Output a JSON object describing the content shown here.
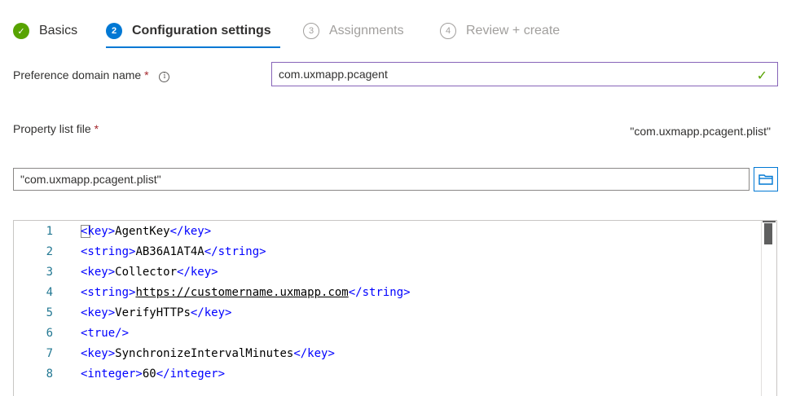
{
  "wizard": {
    "steps": [
      {
        "number": "✓",
        "label": "Basics",
        "state": "done"
      },
      {
        "number": "2",
        "label": "Configuration settings",
        "state": "active"
      },
      {
        "number": "3",
        "label": "Assignments",
        "state": "todo"
      },
      {
        "number": "4",
        "label": "Review + create",
        "state": "todo"
      }
    ]
  },
  "preference": {
    "label": "Preference domain name",
    "required_mark": "*",
    "info_icon": "info-icon",
    "value": "com.uxmapp.pcagent",
    "status_icon": "checkmark-icon"
  },
  "plist": {
    "label": "Property list file",
    "required_mark": "*",
    "selected_filename": "\"com.uxmapp.pcagent.plist\"",
    "field_value": "\"com.uxmapp.pcagent.plist\"",
    "browse_icon": "folder-icon"
  },
  "editor": {
    "lines": [
      {
        "num": "1",
        "text": "<key>AgentKey</key>"
      },
      {
        "num": "2",
        "text": "<string>AB36A1AT4A</string>"
      },
      {
        "num": "3",
        "text": "<key>Collector</key>"
      },
      {
        "num": "4",
        "text": "<string>https://customername.uxmapp.com</string>"
      },
      {
        "num": "5",
        "text": "<key>VerifyHTTPs</key>"
      },
      {
        "num": "6",
        "text": "<true/>"
      },
      {
        "num": "7",
        "text": "<key>SynchronizeIntervalMinutes</key>"
      },
      {
        "num": "8",
        "text": "<integer>60</integer>"
      }
    ]
  }
}
